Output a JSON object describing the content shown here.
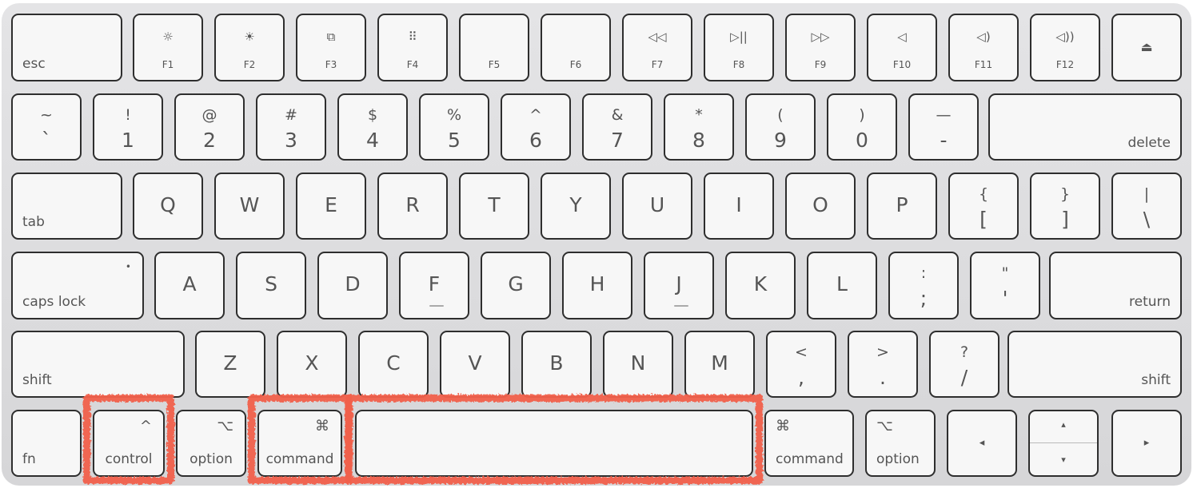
{
  "keyboard": {
    "rows": [
      [
        {
          "label": "esc",
          "type": "mod-l"
        },
        {
          "label": "F1",
          "icon": "brightness-down-icon",
          "glyph": "☼",
          "type": "fkey"
        },
        {
          "label": "F2",
          "icon": "brightness-up-icon",
          "glyph": "☀",
          "type": "fkey"
        },
        {
          "label": "F3",
          "icon": "mission-control-icon",
          "glyph": "⧉",
          "type": "fkey"
        },
        {
          "label": "F4",
          "icon": "launchpad-icon",
          "glyph": "⠿",
          "type": "fkey"
        },
        {
          "label": "F5",
          "type": "fkey"
        },
        {
          "label": "F6",
          "type": "fkey"
        },
        {
          "label": "F7",
          "icon": "rewind-icon",
          "glyph": "◁◁",
          "type": "fkey"
        },
        {
          "label": "F8",
          "icon": "play-pause-icon",
          "glyph": "▷||",
          "type": "fkey"
        },
        {
          "label": "F9",
          "icon": "fast-forward-icon",
          "glyph": "▷▷",
          "type": "fkey"
        },
        {
          "label": "F10",
          "icon": "mute-icon",
          "glyph": "◁",
          "type": "fkey"
        },
        {
          "label": "F11",
          "icon": "volume-down-icon",
          "glyph": "◁)",
          "type": "fkey"
        },
        {
          "label": "F12",
          "icon": "volume-up-icon",
          "glyph": "◁))",
          "type": "fkey"
        },
        {
          "label": "",
          "icon": "eject-icon",
          "glyph": "⏏",
          "type": "eject"
        }
      ],
      [
        {
          "top": "~",
          "bottom": "`",
          "type": "char"
        },
        {
          "top": "!",
          "bottom": "1",
          "type": "char"
        },
        {
          "top": "@",
          "bottom": "2",
          "type": "char"
        },
        {
          "top": "#",
          "bottom": "3",
          "type": "char"
        },
        {
          "top": "$",
          "bottom": "4",
          "type": "char"
        },
        {
          "top": "%",
          "bottom": "5",
          "type": "char"
        },
        {
          "top": "^",
          "bottom": "6",
          "type": "char"
        },
        {
          "top": "&",
          "bottom": "7",
          "type": "char"
        },
        {
          "top": "*",
          "bottom": "8",
          "type": "char"
        },
        {
          "top": "(",
          "bottom": "9",
          "type": "char"
        },
        {
          "top": ")",
          "bottom": "0",
          "type": "char"
        },
        {
          "top": "—",
          "bottom": "-",
          "type": "char"
        },
        {
          "top": "+",
          "bottom": "=",
          "type": "char"
        },
        {
          "label": "delete",
          "type": "mod-r"
        }
      ],
      [
        {
          "label": "tab",
          "type": "mod-l"
        },
        {
          "top": "Q",
          "type": "single"
        },
        {
          "top": "W",
          "type": "single"
        },
        {
          "top": "E",
          "type": "single"
        },
        {
          "top": "R",
          "type": "single"
        },
        {
          "top": "T",
          "type": "single"
        },
        {
          "top": "Y",
          "type": "single"
        },
        {
          "top": "U",
          "type": "single"
        },
        {
          "top": "I",
          "type": "single"
        },
        {
          "top": "O",
          "type": "single"
        },
        {
          "top": "P",
          "type": "single"
        },
        {
          "top": "{",
          "bottom": "[",
          "type": "char"
        },
        {
          "top": "}",
          "bottom": "]",
          "type": "char"
        },
        {
          "top": "|",
          "bottom": "\\",
          "type": "char"
        }
      ],
      [
        {
          "label": "caps lock",
          "type": "mod-l",
          "glyph": "•"
        },
        {
          "top": "A",
          "type": "single"
        },
        {
          "top": "S",
          "type": "single"
        },
        {
          "top": "D",
          "type": "single"
        },
        {
          "top": "F",
          "type": "single",
          "bump": true
        },
        {
          "top": "G",
          "type": "single"
        },
        {
          "top": "H",
          "type": "single"
        },
        {
          "top": "J",
          "type": "single",
          "bump": true
        },
        {
          "top": "K",
          "type": "single"
        },
        {
          "top": "L",
          "type": "single"
        },
        {
          "top": ":",
          "bottom": ";",
          "type": "char"
        },
        {
          "top": "\"",
          "bottom": "'",
          "type": "char"
        },
        {
          "label": "return",
          "type": "mod-r"
        }
      ],
      [
        {
          "label": "shift",
          "type": "mod-l"
        },
        {
          "top": "Z",
          "type": "single"
        },
        {
          "top": "X",
          "type": "single"
        },
        {
          "top": "C",
          "type": "single"
        },
        {
          "top": "V",
          "type": "single"
        },
        {
          "top": "B",
          "type": "single"
        },
        {
          "top": "N",
          "type": "single"
        },
        {
          "top": "M",
          "type": "single"
        },
        {
          "top": "<",
          "bottom": ",",
          "type": "char"
        },
        {
          "top": ">",
          "bottom": ".",
          "type": "char"
        },
        {
          "top": "?",
          "bottom": "/",
          "type": "char"
        },
        {
          "label": "shift",
          "type": "mod-r"
        }
      ],
      [
        {
          "label": "fn",
          "type": "mod-l"
        },
        {
          "label": "control",
          "type": "mod-c",
          "glyph": "^",
          "icon": "control-icon",
          "highlighted": true
        },
        {
          "label": "option",
          "type": "mod-c",
          "glyph": "⌥",
          "icon": "option-icon"
        },
        {
          "label": "command",
          "type": "mod-c",
          "glyph": "⌘",
          "icon": "command-icon",
          "highlighted": true
        },
        {
          "label": "",
          "type": "space",
          "name": "space",
          "highlighted": true
        },
        {
          "label": "command",
          "type": "mod-l",
          "glyph": "⌘",
          "icon": "command-icon",
          "glyphLeft": true
        },
        {
          "label": "option",
          "type": "mod-l",
          "glyph": "⌥",
          "icon": "option-icon",
          "glyphLeft": true
        },
        {
          "label": "",
          "type": "arrow",
          "glyph": "◂",
          "icon": "arrow-left-icon"
        },
        {
          "label": "",
          "type": "updown",
          "glyph": "▴",
          "glyph2": "▾",
          "icon": "arrow-up-down-icon"
        },
        {
          "label": "",
          "type": "arrow",
          "glyph": "▸",
          "icon": "arrow-right-icon"
        }
      ]
    ],
    "highlight_color": "#f2604c"
  }
}
